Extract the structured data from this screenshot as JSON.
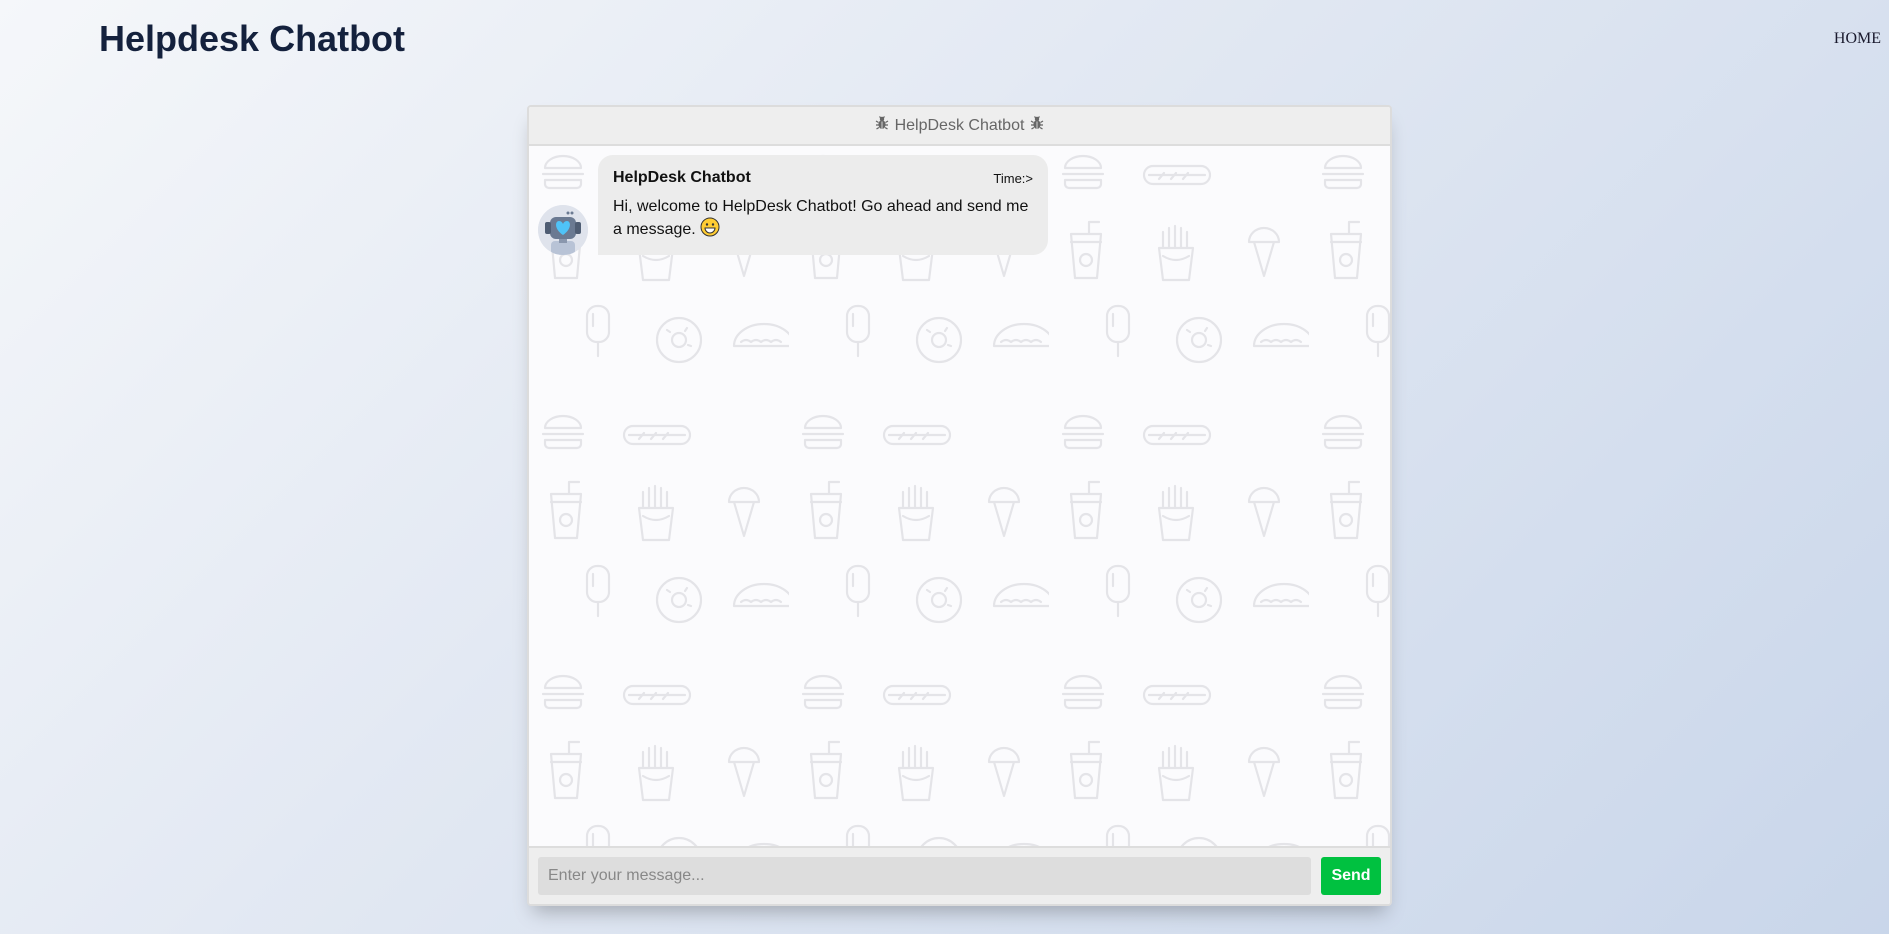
{
  "page": {
    "title": "Helpdesk Chatbot",
    "nav_home": "HOME"
  },
  "chat": {
    "header_title": "HelpDesk Chatbot",
    "header_icon": "bug-icon",
    "messages": [
      {
        "sender": "HelpDesk Chatbot",
        "time": "Time:>",
        "text": "Hi, welcome to HelpDesk Chatbot! Go ahead and send me a message.",
        "emoji": "😄",
        "avatar": "robot-avatar"
      }
    ],
    "input_placeholder": "Enter your message...",
    "input_value": "",
    "send_label": "Send"
  },
  "colors": {
    "title": "#14213d",
    "send_button": "#00c140",
    "bubble": "#ececec",
    "header_bg": "#eeeeee"
  }
}
